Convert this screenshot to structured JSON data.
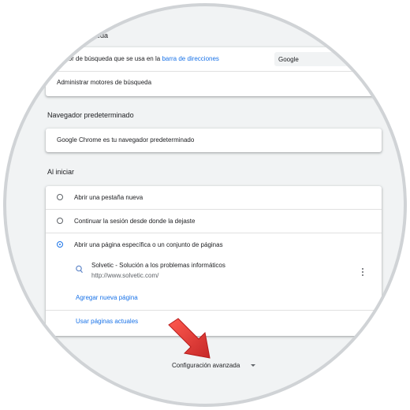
{
  "search_engine": {
    "title_fragment": "queda",
    "row_text_prefix": "otor de búsqueda que se usa en la ",
    "row_link": "barra de direcciones",
    "selected_engine": "Google",
    "manage_label": "Administrar motores de búsqueda"
  },
  "default_browser": {
    "title": "Navegador predeterminado",
    "status": "Google Chrome es tu navegador predeterminado"
  },
  "on_startup": {
    "title": "Al iniciar",
    "options": [
      {
        "label": "Abrir una pestaña nueva",
        "checked": false
      },
      {
        "label": "Continuar la sesión desde donde la dejaste",
        "checked": false
      },
      {
        "label": "Abrir una página específica o un conjunto de páginas",
        "checked": true
      }
    ],
    "page_title": "Solvetic - Solución a los problemas informáticos",
    "page_url": "http://www.solvetic.com/",
    "add_page": "Agregar nueva página",
    "use_current": "Usar páginas actuales"
  },
  "advanced": {
    "label": "Configuración avanzada"
  },
  "colors": {
    "accent": "#1a73e8",
    "arrow": "#e53935",
    "frame_ring": "#d0d3d6"
  }
}
